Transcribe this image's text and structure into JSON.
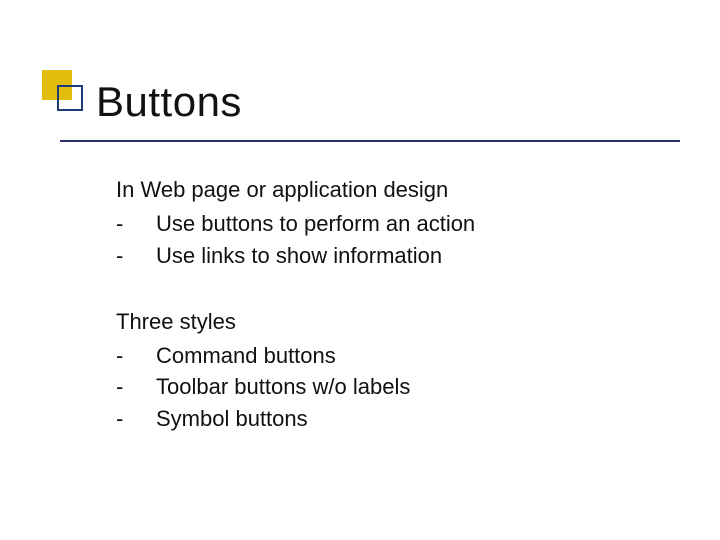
{
  "title": "Buttons",
  "section1": {
    "lead": "In Web page or application design",
    "items": [
      "Use buttons to perform an action",
      "Use links to show information"
    ]
  },
  "section2": {
    "lead": "Three styles",
    "items": [
      "Command buttons",
      "Toolbar buttons w/o labels",
      "Symbol buttons"
    ]
  },
  "bullet": "-"
}
